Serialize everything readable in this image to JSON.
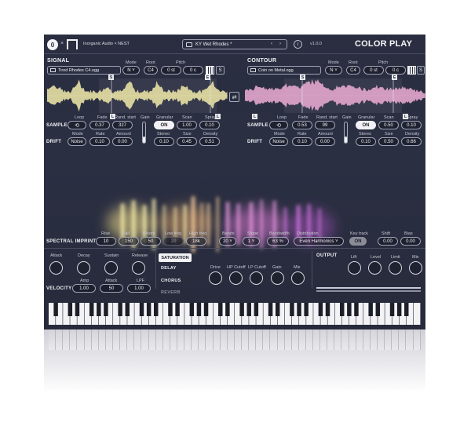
{
  "header": {
    "logo_letter": "0",
    "brand_x": "×",
    "brand_text": "Inorganic Audio × NEST",
    "preset_name": "KY Wet Rhodes *",
    "info": "i",
    "version": "v1.0.0",
    "app_title": "COLOR PLAY"
  },
  "signal": {
    "title": "SIGNAL",
    "file": "Tired Rhodes C4.ogg",
    "mode_label": "Mode",
    "mode_value": "N",
    "root_label": "Root",
    "root_value": "C4",
    "pitch_label": "Pitch",
    "pitch_st": "0 st",
    "pitch_c": "0 c",
    "s_label": "S",
    "markers": [
      "S",
      "E",
      "L",
      "L"
    ],
    "sample_label": "SAMPLE",
    "drift_label": "DRIFT",
    "loop_label": "Loop",
    "fade_label": "Fade",
    "fade_value": "0.37",
    "rand_label": "Rand. start",
    "rand_value": "327",
    "gain_label": "Gain",
    "granular_label": "Granular",
    "granular_value": "ON",
    "scan_label": "Scan",
    "scan_value": "1.00",
    "spray_label": "Spray",
    "spray_value": "0.10",
    "dmode_label": "Mode",
    "dmode_value": "Noise",
    "rate_label": "Rate",
    "rate_value": "0.10",
    "amount_label": "Amount",
    "amount_value": "0.00",
    "stereo_label": "Stereo",
    "stereo_value": "0.10",
    "size_label": "Size",
    "size_value": "0.45",
    "density_label": "Density",
    "density_value": "0.51",
    "gain_level": 0.3
  },
  "contour": {
    "title": "CONTOUR",
    "file": "Coin on Metal.ogg",
    "mode_label": "Mode",
    "mode_value": "N",
    "root_label": "Root",
    "root_value": "C4",
    "pitch_label": "Pitch",
    "pitch_st": "0 st",
    "pitch_c": "0 c",
    "s_label": "S",
    "markers": [
      "S",
      "E",
      "L",
      "L"
    ],
    "sample_label": "SAMPLE",
    "drift_label": "DRIFT",
    "loop_label": "Loop",
    "fade_label": "Fade",
    "fade_value": "0.53",
    "rand_label": "Rand. start",
    "rand_value": "99",
    "gain_label": "Gain",
    "granular_label": "Granular",
    "granular_value": "ON",
    "scan_label": "Scan",
    "scan_value": "0.50",
    "spray_label": "Spray",
    "spray_value": "0.10",
    "dmode_label": "Mode",
    "dmode_value": "Noise",
    "rate_label": "Rate",
    "rate_value": "0.10",
    "amount_label": "Amount",
    "amount_value": "0.00",
    "stereo_label": "Stereo",
    "stereo_value": "0.10",
    "size_label": "Size",
    "size_value": "0.50",
    "density_label": "Density",
    "density_value": "0.66",
    "gain_level": 0.3
  },
  "spectral": {
    "title": "SPECTRAL IMPRINT",
    "rise_label": "Rise",
    "rise_value": "10",
    "fall_label": "Fall",
    "fall_value": "150",
    "bloom_label": "Bloom",
    "bloom_value": "50",
    "lowfreq_label": "Low freq",
    "lowfreq_value": "20",
    "highfreq_label": "High freq",
    "highfreq_value": "18k",
    "bands_label": "Bands",
    "bands_value": "20",
    "slope_label": "Slope",
    "slope_value": "1",
    "bandwidth_label": "Bandwidth",
    "bandwidth_value": "63 %",
    "distribution_label": "Distribution",
    "distribution_value": "Even Harmonics",
    "keytrack_label": "Key track",
    "keytrack_value": "ON",
    "shift_label": "Shift",
    "shift_value": "0.00",
    "bias_label": "Bias",
    "bias_value": "0.00"
  },
  "envelope": {
    "attack_label": "Attack",
    "decay_label": "Decay",
    "sustain_label": "Sustain",
    "release_label": "Release",
    "velocity_label": "VELOCITY",
    "amp_label": "Amp",
    "amp_value": "1.00",
    "vattack_label": "Attack",
    "vattack_value": "50",
    "lpf_label": "LPF",
    "lpf_value": "1.00"
  },
  "effects": {
    "tabs": [
      "SATURATION",
      "DELAY",
      "CHORUS",
      "REVERB"
    ],
    "active_tab": "SATURATION",
    "knobs": [
      "Drive",
      "HP Cutoff",
      "LP Cutoff",
      "Gain",
      "Mix"
    ]
  },
  "output": {
    "title": "OUTPUT",
    "knobs": [
      "Lift",
      "Level",
      "Limit",
      "Mix"
    ]
  },
  "colors": {
    "panel_bg": "#2a2e40",
    "signal_wave": "#e7e0a4",
    "contour_wave": "#e3a6cd",
    "accent": "#f2f2f6"
  }
}
